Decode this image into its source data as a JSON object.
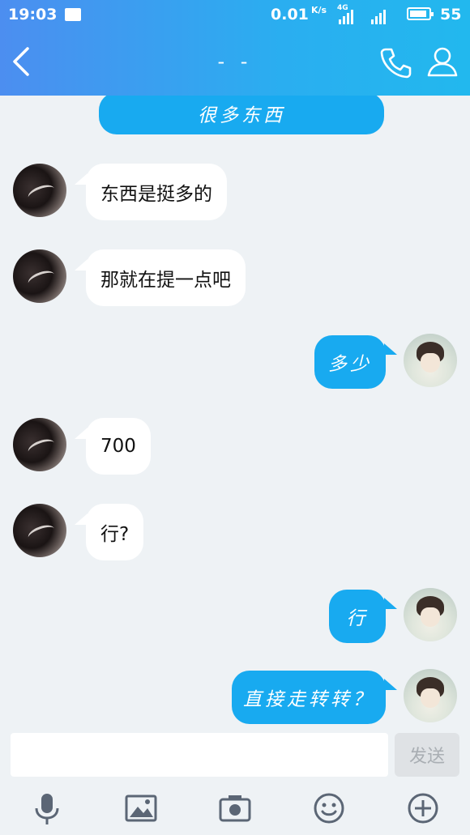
{
  "status_bar": {
    "time": "19:03",
    "speed": "0.01",
    "speed_unit": "K/s",
    "network": "4G",
    "battery": "55"
  },
  "header": {
    "title": "- -",
    "back_icon": "chevron-left-icon",
    "phone_icon": "phone-icon",
    "profile_icon": "user-icon"
  },
  "messages": [
    {
      "side": "right",
      "text": "很多东西"
    },
    {
      "side": "left",
      "text": "东西是挺多的"
    },
    {
      "side": "left",
      "text": "那就在提一点吧"
    },
    {
      "side": "right",
      "text": "多少"
    },
    {
      "side": "left",
      "text": "700"
    },
    {
      "side": "left",
      "text": "行?"
    },
    {
      "side": "right",
      "text": "行"
    },
    {
      "side": "right",
      "text": "直接走转转？"
    }
  ],
  "composer": {
    "input_value": "",
    "send_label": "发送"
  },
  "toolbar": {
    "items": [
      "microphone-icon",
      "image-icon",
      "camera-icon",
      "emoji-icon",
      "plus-icon"
    ]
  },
  "colors": {
    "header_start": "#4c8ef0",
    "header_end": "#22b8ee",
    "my_bubble": "#18aaf0",
    "their_bubble": "#ffffff",
    "background": "#eef2f5"
  }
}
